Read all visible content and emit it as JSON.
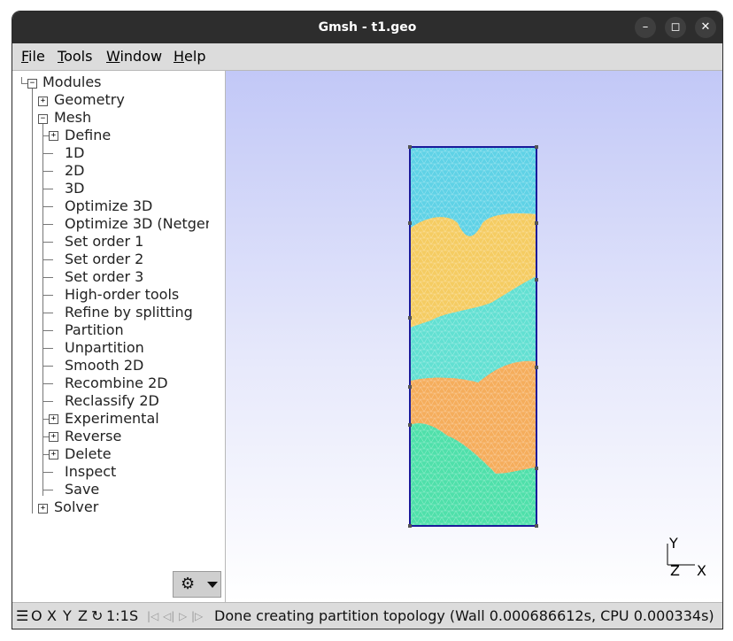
{
  "window": {
    "title": "Gmsh - t1.geo",
    "controls": {
      "minimize": "–",
      "maximize": "◻",
      "close": "✕"
    }
  },
  "menubar": [
    {
      "key": "F",
      "rest": "ile"
    },
    {
      "key": "T",
      "rest": "ools"
    },
    {
      "key": "W",
      "rest": "indow"
    },
    {
      "key": "H",
      "rest": "elp"
    }
  ],
  "tree": {
    "root": "Modules",
    "geometry": "Geometry",
    "mesh": "Mesh",
    "mesh_items": [
      {
        "label": "Define",
        "expandable": true
      },
      {
        "label": "1D",
        "expandable": false
      },
      {
        "label": "2D",
        "expandable": false
      },
      {
        "label": "3D",
        "expandable": false
      },
      {
        "label": "Optimize 3D",
        "expandable": false
      },
      {
        "label": "Optimize 3D (Netgen)",
        "expandable": false
      },
      {
        "label": "Set order 1",
        "expandable": false
      },
      {
        "label": "Set order 2",
        "expandable": false
      },
      {
        "label": "Set order 3",
        "expandable": false
      },
      {
        "label": "High-order tools",
        "expandable": false
      },
      {
        "label": "Refine by splitting",
        "expandable": false
      },
      {
        "label": "Partition",
        "expandable": false
      },
      {
        "label": "Unpartition",
        "expandable": false
      },
      {
        "label": "Smooth 2D",
        "expandable": false
      },
      {
        "label": "Recombine 2D",
        "expandable": false
      },
      {
        "label": "Reclassify 2D",
        "expandable": false
      },
      {
        "label": "Experimental",
        "expandable": true
      },
      {
        "label": "Reverse",
        "expandable": true
      },
      {
        "label": "Delete",
        "expandable": true
      },
      {
        "label": "Inspect",
        "expandable": false
      },
      {
        "label": "Save",
        "expandable": false
      }
    ],
    "solver": "Solver",
    "expand_symbol": "+",
    "collapse_symbol": "−"
  },
  "gear_button": {
    "icon": "gear-icon",
    "glyph": "⚙"
  },
  "axes": {
    "y": "Y",
    "z": "Z",
    "x": "X"
  },
  "mesh_colors": {
    "partition_1": "#5fd2e6",
    "partition_2": "#f5cc62",
    "partition_3": "#62e0d2",
    "partition_4": "#f5ad5c",
    "partition_5": "#4fe0aa",
    "boundary": "#1a1a9a"
  },
  "statusbar": {
    "menu_icon": "☰",
    "o": "O",
    "x": "X",
    "y": "Y",
    "z": "Z",
    "rotate_icon": "↻",
    "scale": "1:1",
    "s": "S",
    "nav": [
      "|◁",
      "◁|",
      "▷",
      "|▷"
    ],
    "message": "Done creating partition topology (Wall 0.000686612s, CPU 0.000334s)"
  }
}
